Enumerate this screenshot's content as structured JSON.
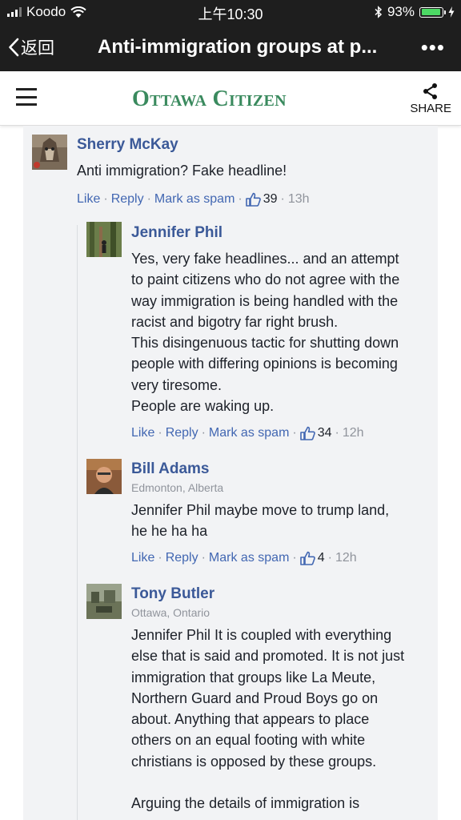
{
  "status_bar": {
    "carrier": "Koodo",
    "time": "上午10:30",
    "battery_percent": "93%",
    "battery_level": 0.93
  },
  "nav": {
    "back_label": "返回",
    "title": "Anti-immigration groups at p...",
    "more_label": "•••"
  },
  "site": {
    "logo": "Ottawa Citizen",
    "share_label": "SHARE",
    "brand_color": "#3a8a5e"
  },
  "comments": [
    {
      "name": "Sherry McKay",
      "location": "",
      "lines": [
        "Anti immigration? Fake headline!"
      ],
      "like_label": "Like",
      "reply_label": "Reply",
      "spam_label": "Mark as spam",
      "likes": "39",
      "time": "13h"
    },
    {
      "name": "Jennifer Phil",
      "location": "",
      "lines": [
        "Yes, very fake headlines... and an attempt",
        "to paint citizens who do not agree with the",
        "way immigration is being handled with the",
        "racist and bigotry far right brush.",
        "This disingenuous tactic for shutting down",
        "people with differing opinions is becoming",
        "very tiresome.",
        "People are waking up."
      ],
      "like_label": "Like",
      "reply_label": "Reply",
      "spam_label": "Mark as spam",
      "likes": "34",
      "time": "12h"
    },
    {
      "name": "Bill Adams",
      "location": "Edmonton, Alberta",
      "lines": [
        "Jennifer Phil maybe move to trump land,",
        "he he ha ha"
      ],
      "like_label": "Like",
      "reply_label": "Reply",
      "spam_label": "Mark as spam",
      "likes": "4",
      "time": "12h"
    },
    {
      "name": "Tony Butler",
      "location": "Ottawa, Ontario",
      "lines": [
        "Jennifer Phil It is coupled with everything",
        "else that is said and promoted. It is not just",
        "immigration that groups like La Meute,",
        "Northern Guard and Proud Boys go on",
        "about. Anything that appears to place",
        "others on an equal footing with white",
        "christians is opposed by these groups.",
        "",
        "Arguing the details of immigration is"
      ]
    }
  ]
}
